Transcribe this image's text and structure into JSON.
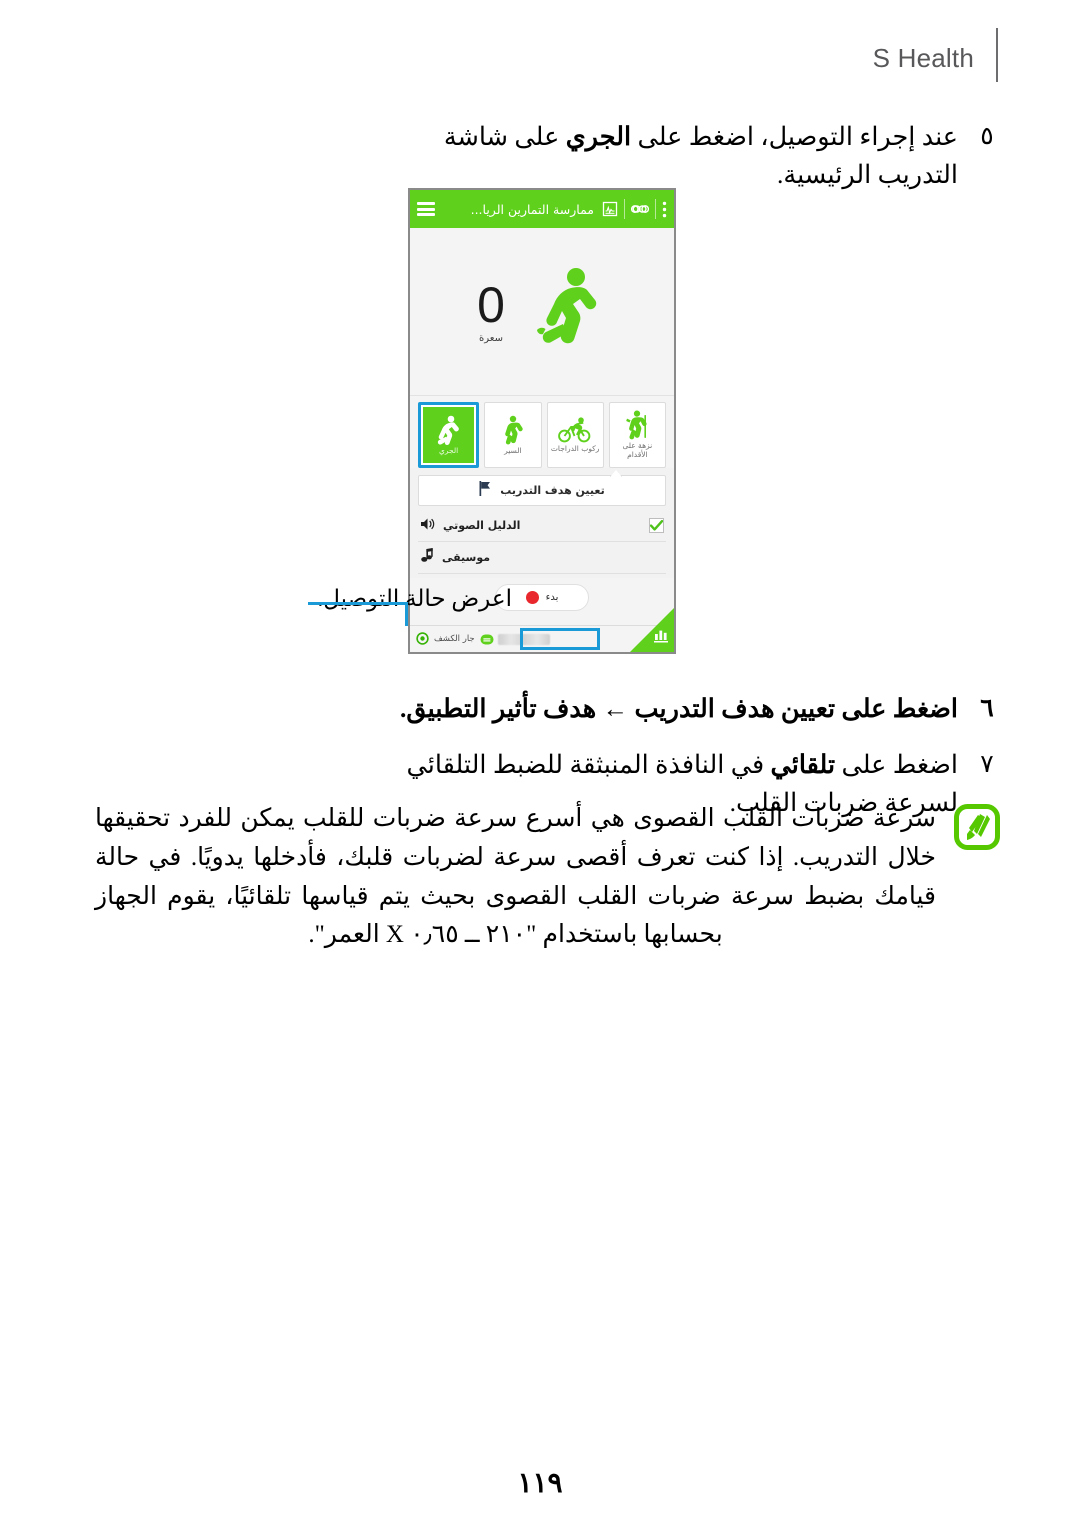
{
  "header": {
    "title": "S Health"
  },
  "steps": [
    {
      "num": "٥",
      "text": "عند إجراء التوصيل، اضغط على الجري على شاشة التدريب الرئيسية."
    },
    {
      "num": "٦",
      "text": "اضغط على تعيين هدف التدريب ← هدف تأثير التطبيق."
    },
    {
      "num": "٧",
      "text": "اضغط على تلقائي في النافذة المنبثقة للضبط التلقائي لسرعة ضربات القلب."
    }
  ],
  "note": {
    "icon": "samsung-note-icon",
    "text": "سرعة ضربات القلب القصوى هي أسرع سرعة ضربات للقلب يمكن للفرد تحقيقها خلال التدريب. إذا كنت تعرف أقصى سرعة لضربات قلبك، فأدخلها يدويًا. في حالة قيامك بضبط سرعة ضربات القلب القصوى بحيث يتم قياسها تلقائيًا، يقوم الجهاز بحسابها باستخدام \"٢١٠ ــ ٠٫٦٥ X العمر\"."
  },
  "callout": {
    "label": "اعرض حالة التوصيل."
  },
  "page_number": "١١٩",
  "colors": {
    "brand_green": "#5fd01c",
    "highlight_blue": "#1a9bd7",
    "record_red": "#e8282c",
    "header_gray": "#58585a"
  },
  "screenshot": {
    "appbar": {
      "menu_icon": "hamburger-icon",
      "title": "ممارسة التمارين الريا...",
      "chart_icon": "heart-rate-chart-icon",
      "link_icon": "link-chain-icon",
      "overflow_icon": "more-vertical-icon"
    },
    "stage": {
      "activity_icon": "running-figure-icon",
      "calorie_value": "0",
      "calorie_unit": "سعرة"
    },
    "tiles": [
      {
        "label": "الجري",
        "icon": "running-icon",
        "selected": true
      },
      {
        "label": "السير",
        "icon": "walking-icon",
        "selected": false
      },
      {
        "label": "ركوب الدراجات",
        "icon": "cycling-icon",
        "selected": false
      },
      {
        "label": "نزهة على الأقدام",
        "icon": "hiking-icon",
        "selected": false
      }
    ],
    "goal_row": {
      "icon": "flag-icon",
      "label": "تعيين هدف التدريب"
    },
    "options": [
      {
        "label": "الدليل الصوتي",
        "icon": "speaker-icon",
        "checked": true
      },
      {
        "label": "موسيقى",
        "icon": "music-note-icon",
        "checked": false
      }
    ],
    "start_button": {
      "label": "بدء",
      "icon": "record-dot-icon"
    },
    "status_bar": {
      "gps_icon": "gps-target-icon",
      "gps_label": "جار الكشف",
      "connection_icon": "connected-band-icon",
      "connection_value": ""
    },
    "corner_icon": "bar-chart-icon"
  }
}
